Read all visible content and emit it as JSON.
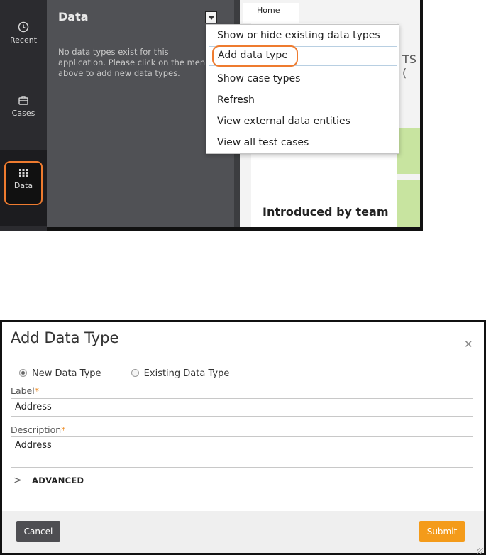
{
  "sidebar": {
    "items": [
      {
        "label": "Recent",
        "icon": "clock-icon"
      },
      {
        "label": "Cases",
        "icon": "briefcase-icon"
      },
      {
        "label": "Data",
        "icon": "grid-icon"
      }
    ]
  },
  "data_panel": {
    "title": "Data",
    "empty_message": "No data types exist for this application. Please click on the menu above to add new data types."
  },
  "main_area": {
    "tab": "Home",
    "heading_fragment": "TS (",
    "section_heading": "Introduced by team"
  },
  "dropdown_menu": {
    "items": [
      "Show or hide existing data types",
      "Add data type",
      "Show case types",
      "Refresh",
      "View external data entities",
      "View all test cases"
    ]
  },
  "dialog": {
    "title": "Add Data Type",
    "options": [
      "New Data Type",
      "Existing Data Type"
    ],
    "selected_option": "New Data Type",
    "label_field": {
      "label": "Label",
      "value": "Address"
    },
    "description_field": {
      "label": "Description",
      "value": "Address"
    },
    "advanced_label": "ADVANCED",
    "cancel_label": "Cancel",
    "submit_label": "Submit"
  },
  "colors": {
    "highlight_ring": "#ee7b2f",
    "submit_button": "#f49b1a",
    "required_star": "#ee8f2a"
  }
}
